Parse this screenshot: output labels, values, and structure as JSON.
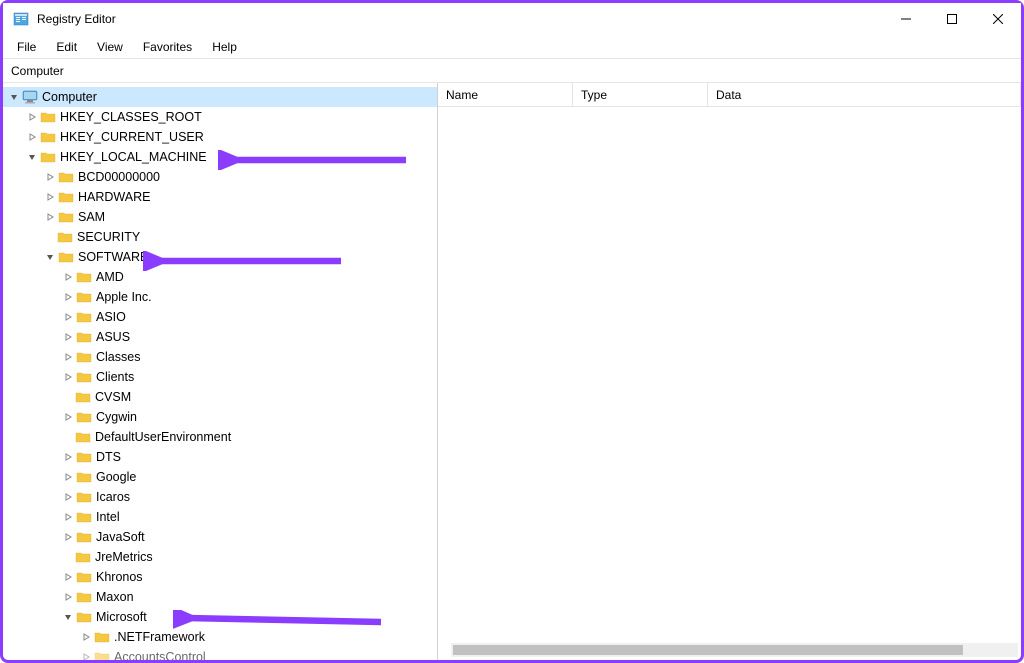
{
  "window": {
    "title": "Registry Editor"
  },
  "menu": {
    "file": "File",
    "edit": "Edit",
    "view": "View",
    "favorites": "Favorites",
    "help": "Help"
  },
  "addressbar": {
    "path": "Computer"
  },
  "listHeader": {
    "name": "Name",
    "type": "Type",
    "data": "Data"
  },
  "tree": {
    "computer": "Computer",
    "hkcr": "HKEY_CLASSES_ROOT",
    "hkcu": "HKEY_CURRENT_USER",
    "hklm": "HKEY_LOCAL_MACHINE",
    "bcd": "BCD00000000",
    "hardware": "HARDWARE",
    "sam": "SAM",
    "security": "SECURITY",
    "software": "SOFTWARE",
    "amd": "AMD",
    "apple": "Apple Inc.",
    "asio": "ASIO",
    "asus": "ASUS",
    "classes": "Classes",
    "clients": "Clients",
    "cvsm": "CVSM",
    "cygwin": "Cygwin",
    "defaultuser": "DefaultUserEnvironment",
    "dts": "DTS",
    "google": "Google",
    "icaros": "Icaros",
    "intel": "Intel",
    "javasoft": "JavaSoft",
    "jremetrics": "JreMetrics",
    "khronos": "Khronos",
    "maxon": "Maxon",
    "microsoft": "Microsoft",
    "netframework": ".NETFramework",
    "accountscontrol": "AccountsControl"
  }
}
